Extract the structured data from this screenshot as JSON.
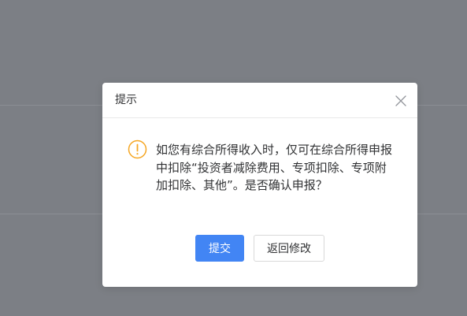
{
  "dialog": {
    "title": "提示",
    "message": "如您有综合所得收入时，仅可在综合所得申报中扣除“投资者减除费用、专项扣除、专项附加扣除、其他”。是否确认申报？",
    "buttons": {
      "submit": "提交",
      "back": "返回修改"
    },
    "icons": {
      "close": "close-icon",
      "warning": "warning-circle-icon"
    }
  },
  "colors": {
    "overlay": "#7c7f85",
    "primary": "#4285f4",
    "warning": "#f5a623",
    "text": "#303133"
  }
}
